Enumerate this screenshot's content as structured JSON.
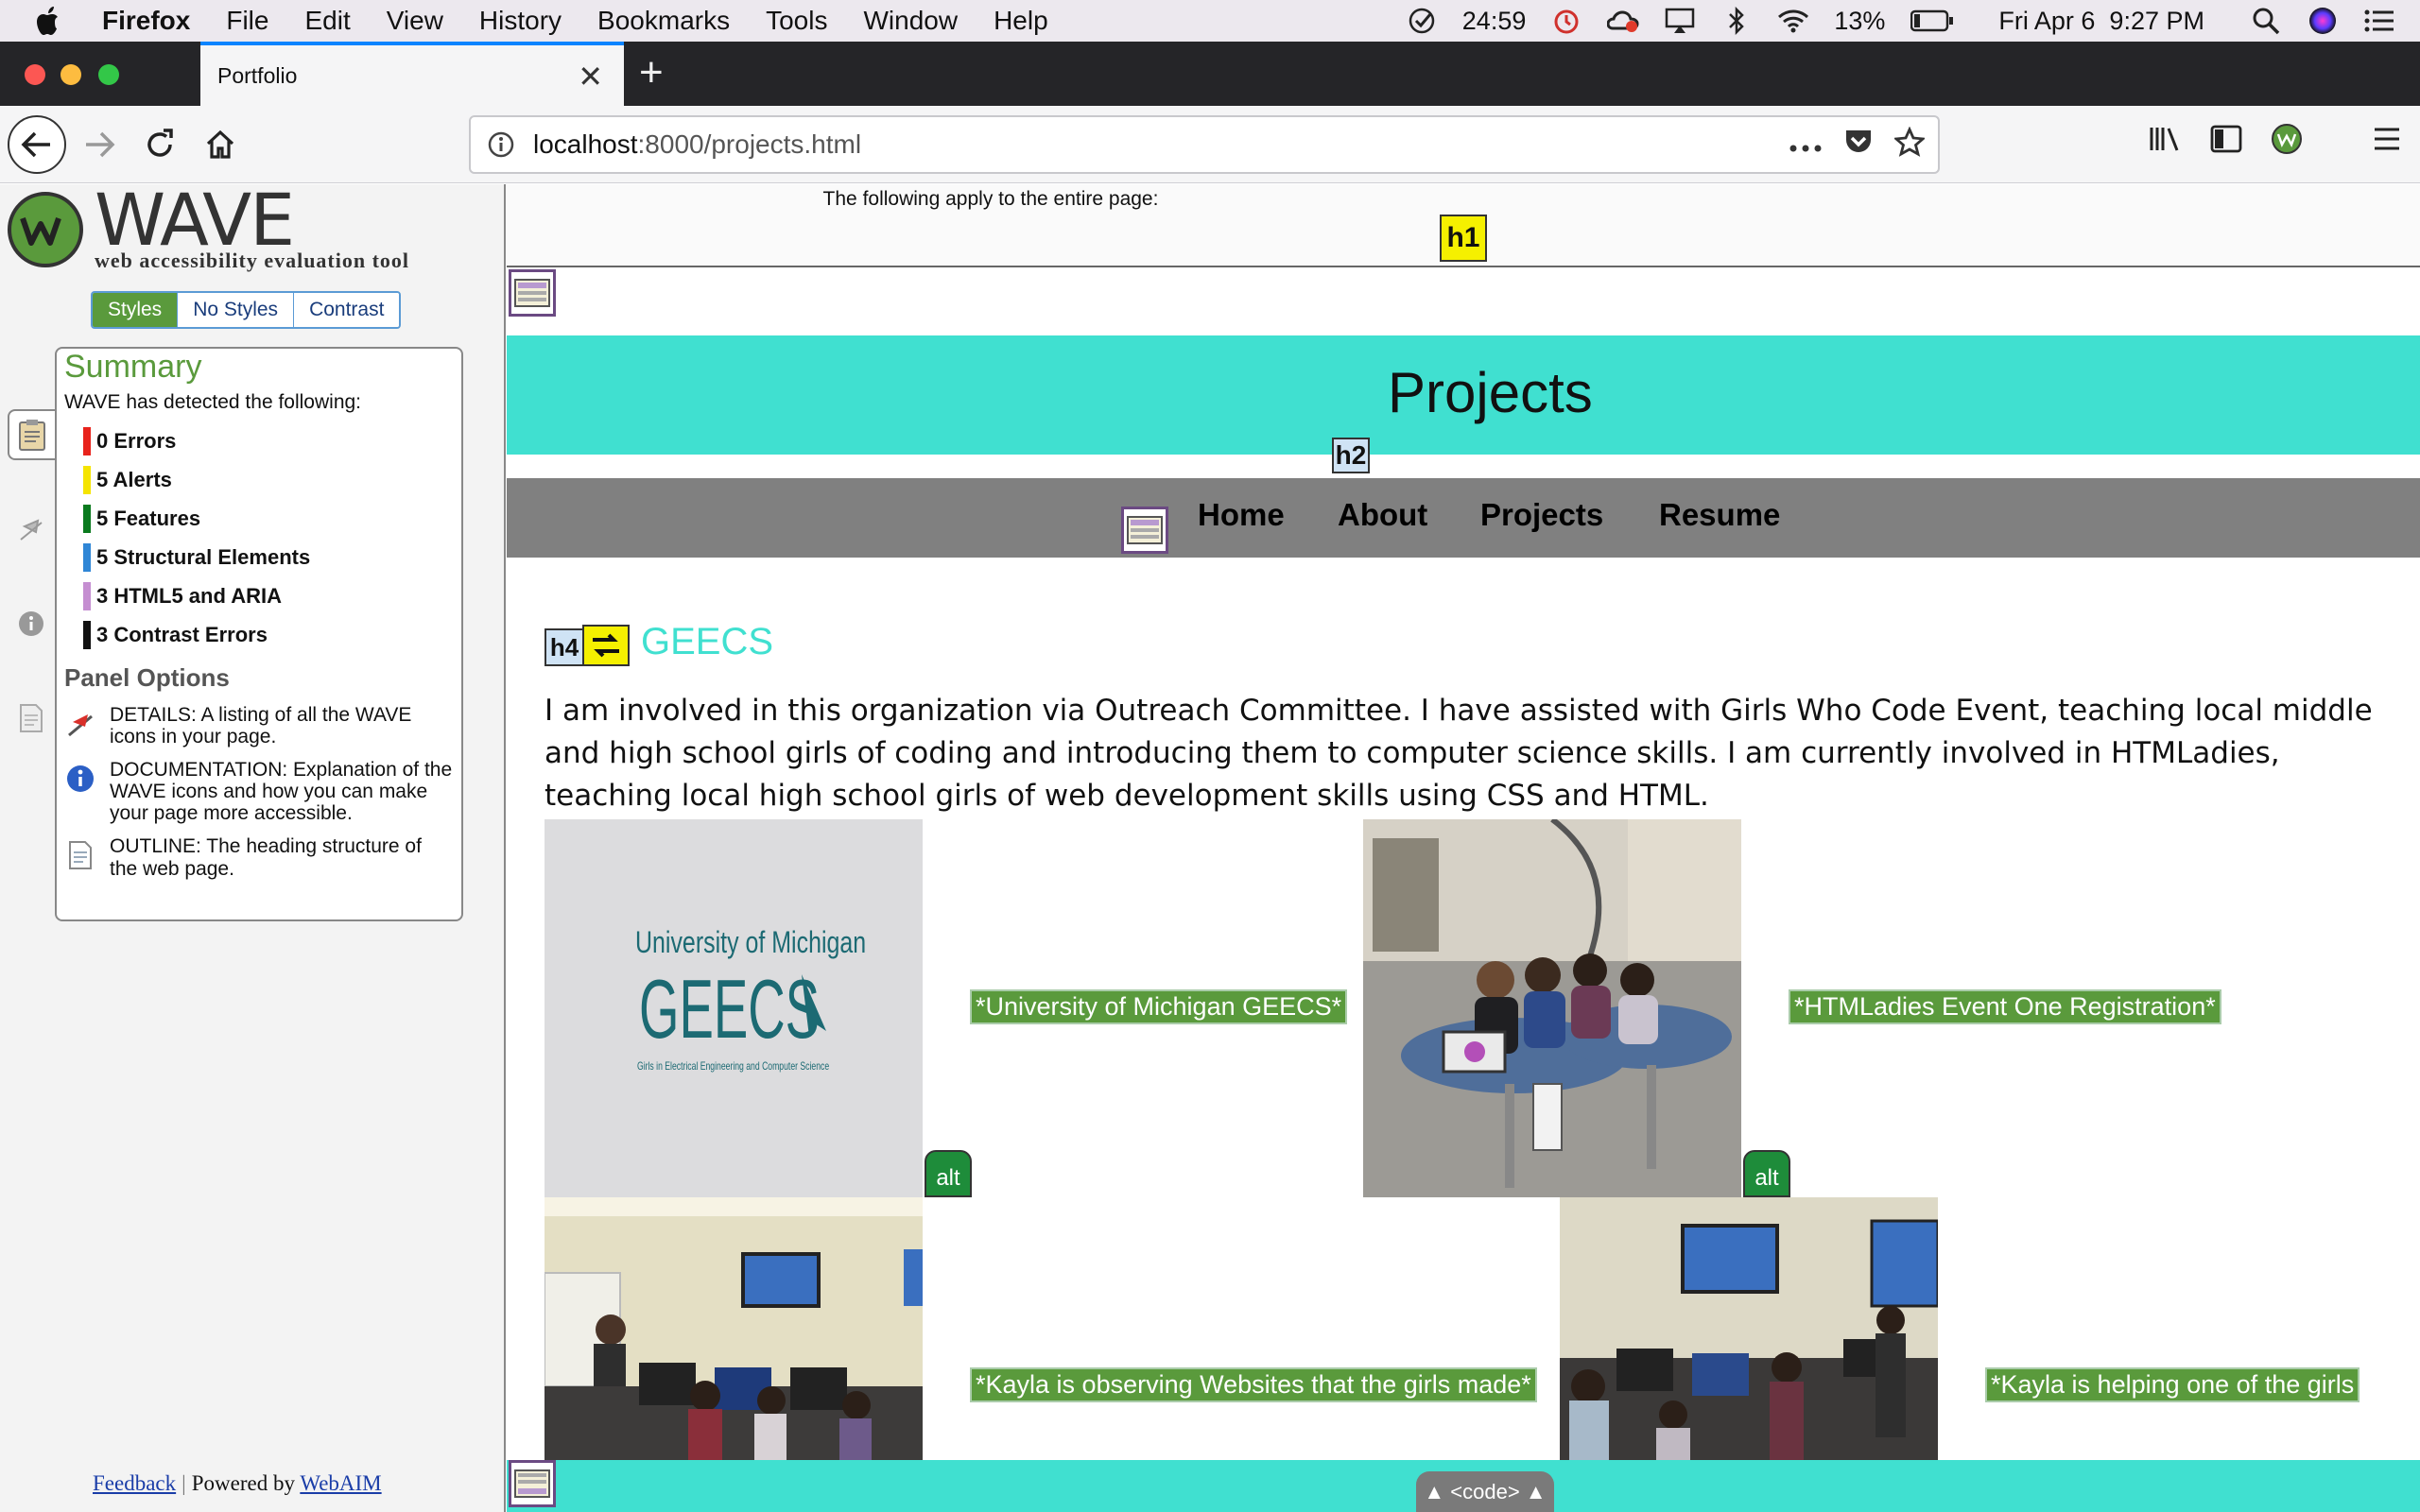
{
  "menubar": {
    "app_name": "Firefox",
    "items": [
      "File",
      "Edit",
      "View",
      "History",
      "Bookmarks",
      "Tools",
      "Window",
      "Help"
    ],
    "timer": "24:59",
    "battery": "13%",
    "datetime": "Fri Apr 6  9:27 PM"
  },
  "browser": {
    "tab_title": "Portfolio",
    "url_host": "localhost",
    "url_path": ":8000/projects.html"
  },
  "wave": {
    "title": "WAVE",
    "subtitle": "web accessibility evaluation tool",
    "modes": [
      "Styles",
      "No Styles",
      "Contrast"
    ],
    "summary_heading": "Summary",
    "summary_intro": "WAVE has detected the following:",
    "summary_items": [
      {
        "label": "0 Errors",
        "color": "#e8231c"
      },
      {
        "label": "5 Alerts",
        "color": "#f5e400"
      },
      {
        "label": "5 Features",
        "color": "#0a7a1e"
      },
      {
        "label": "5 Structural Elements",
        "color": "#2f86d6"
      },
      {
        "label": "3 HTML5 and ARIA",
        "color": "#c58ed1"
      },
      {
        "label": "3 Contrast Errors",
        "color": "#111111"
      }
    ],
    "panel_options_heading": "Panel Options",
    "panel_options": [
      {
        "icon": "flag-icon",
        "text": "DETAILS: A listing of all the WAVE icons in your page."
      },
      {
        "icon": "info-icon",
        "text": "DOCUMENTATION: Explanation of the WAVE icons and how you can make your page more accessible."
      },
      {
        "icon": "document-icon",
        "text": "OUTLINE: The heading structure of the web page."
      }
    ],
    "footer_feedback": "Feedback",
    "footer_sep": "|",
    "footer_powered": "Powered by",
    "footer_webaim": "WebAIM"
  },
  "page": {
    "applies_note": "The following apply to the entire page:",
    "h1_label": "h1",
    "h2_label": "h2",
    "h4_label": "h4",
    "banner_title": "Projects",
    "nav_links": [
      "Home",
      "About",
      "Projects",
      "Resume"
    ],
    "section_heading": "GEECS",
    "paragraph": "I am involved in this organization via Outreach Committee. I have assisted with Girls Who Code Event, teaching local middle and high school girls of coding and introducing them to computer science skills. I am currently involved in HTMLadies, teaching local high school girls of web development skills using CSS and HTML.",
    "geecs_logo_line1": "University of Michigan",
    "geecs_logo_line2": "GEECS",
    "geecs_logo_line3": "Girls in Electrical Engineering and Computer Science",
    "alt_texts": [
      "*University of Michigan GEECS*",
      "*HTMLadies Event One Registration*",
      "*Kayla is observing Websites that the girls made*",
      "*Kayla is helping one of the girls"
    ],
    "alt_icon_label": "alt",
    "code_tab": "▲ <code> ▲"
  }
}
